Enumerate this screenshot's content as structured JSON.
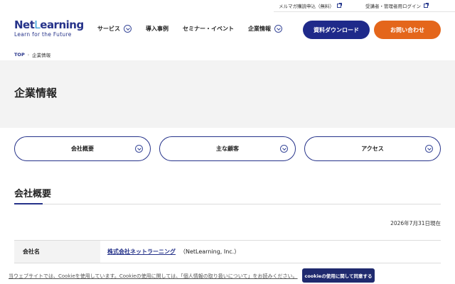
{
  "util_links": [
    {
      "label": "メルマガ購読申込（無料）"
    },
    {
      "label": "受講者・管理者用ログイン"
    }
  ],
  "logo": {
    "main_prefix": "Net",
    "main_suffix": "earning",
    "mark": "L",
    "tagline": "Learn for the Future"
  },
  "nav": [
    {
      "label": "サービス",
      "has_dropdown": true
    },
    {
      "label": "導入事例",
      "has_dropdown": false
    },
    {
      "label": "セミナー・イベント",
      "has_dropdown": false
    },
    {
      "label": "企業情報",
      "has_dropdown": true
    }
  ],
  "header_buttons": {
    "download": "資料ダウンロード",
    "contact": "お問い合わせ"
  },
  "breadcrumb": {
    "home": "TOP",
    "separator": "›",
    "current": "企業情報"
  },
  "page_title": "企業情報",
  "tabs": [
    {
      "label": "会社概要"
    },
    {
      "label": "主な顧客"
    },
    {
      "label": "アクセス"
    }
  ],
  "section": {
    "heading": "会社概要",
    "as_of": "2026年7月31日現在"
  },
  "info_table": [
    {
      "label": "会社名",
      "value_link": "株式会社ネットラーニング",
      "value_extra": "（NetLearning, Inc.）"
    }
  ],
  "cookie": {
    "text": "当ウェブサイトでは、Cookieを使用しています。Cookieの使用に関しては、「個人情報の取り扱いについて」をお読みください。",
    "button": "cookieの使用に関して同意する"
  },
  "colors": {
    "brand_navy": "#26338a",
    "accent_orange": "#e4661b",
    "light_bg": "#f3f3f3"
  }
}
